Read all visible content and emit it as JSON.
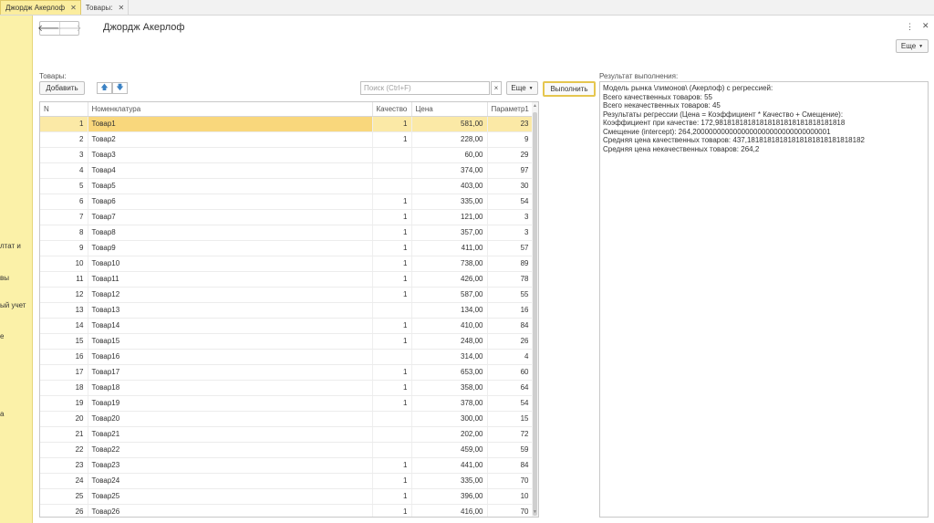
{
  "tabs": [
    {
      "label": "Джордж Акерлоф",
      "active": true
    },
    {
      "label": "Товары:",
      "active": false
    }
  ],
  "sidebar": {
    "items": [
      "",
      "лтат и",
      "вы",
      "ый учет",
      "е",
      "а"
    ]
  },
  "header": {
    "title": "Джордж Акерлоф",
    "more_label": "Еще"
  },
  "goods_panel": {
    "label": "Товары:",
    "add_label": "Добавить",
    "search_placeholder": "Поиск (Ctrl+F)",
    "clear_label": "×",
    "more_label": "Еще",
    "run_label": "Выполнить",
    "columns": [
      "N",
      "Номенклатура",
      "Качество",
      "Цена",
      "Параметр1"
    ],
    "rows": [
      {
        "n": "1",
        "name": "Товар1",
        "quality": "1",
        "price": "581,00",
        "param": "23"
      },
      {
        "n": "2",
        "name": "Товар2",
        "quality": "1",
        "price": "228,00",
        "param": "9"
      },
      {
        "n": "3",
        "name": "Товар3",
        "quality": "",
        "price": "60,00",
        "param": "29"
      },
      {
        "n": "4",
        "name": "Товар4",
        "quality": "",
        "price": "374,00",
        "param": "97"
      },
      {
        "n": "5",
        "name": "Товар5",
        "quality": "",
        "price": "403,00",
        "param": "30"
      },
      {
        "n": "6",
        "name": "Товар6",
        "quality": "1",
        "price": "335,00",
        "param": "54"
      },
      {
        "n": "7",
        "name": "Товар7",
        "quality": "1",
        "price": "121,00",
        "param": "3"
      },
      {
        "n": "8",
        "name": "Товар8",
        "quality": "1",
        "price": "357,00",
        "param": "3"
      },
      {
        "n": "9",
        "name": "Товар9",
        "quality": "1",
        "price": "411,00",
        "param": "57"
      },
      {
        "n": "10",
        "name": "Товар10",
        "quality": "1",
        "price": "738,00",
        "param": "89"
      },
      {
        "n": "11",
        "name": "Товар11",
        "quality": "1",
        "price": "426,00",
        "param": "78"
      },
      {
        "n": "12",
        "name": "Товар12",
        "quality": "1",
        "price": "587,00",
        "param": "55"
      },
      {
        "n": "13",
        "name": "Товар13",
        "quality": "",
        "price": "134,00",
        "param": "16"
      },
      {
        "n": "14",
        "name": "Товар14",
        "quality": "1",
        "price": "410,00",
        "param": "84"
      },
      {
        "n": "15",
        "name": "Товар15",
        "quality": "1",
        "price": "248,00",
        "param": "26"
      },
      {
        "n": "16",
        "name": "Товар16",
        "quality": "",
        "price": "314,00",
        "param": "4"
      },
      {
        "n": "17",
        "name": "Товар17",
        "quality": "1",
        "price": "653,00",
        "param": "60"
      },
      {
        "n": "18",
        "name": "Товар18",
        "quality": "1",
        "price": "358,00",
        "param": "64"
      },
      {
        "n": "19",
        "name": "Товар19",
        "quality": "1",
        "price": "378,00",
        "param": "54"
      },
      {
        "n": "20",
        "name": "Товар20",
        "quality": "",
        "price": "300,00",
        "param": "15"
      },
      {
        "n": "21",
        "name": "Товар21",
        "quality": "",
        "price": "202,00",
        "param": "72"
      },
      {
        "n": "22",
        "name": "Товар22",
        "quality": "",
        "price": "459,00",
        "param": "59"
      },
      {
        "n": "23",
        "name": "Товар23",
        "quality": "1",
        "price": "441,00",
        "param": "84"
      },
      {
        "n": "24",
        "name": "Товар24",
        "quality": "1",
        "price": "335,00",
        "param": "70"
      },
      {
        "n": "25",
        "name": "Товар25",
        "quality": "1",
        "price": "396,00",
        "param": "10"
      },
      {
        "n": "26",
        "name": "Товар26",
        "quality": "1",
        "price": "416,00",
        "param": "70"
      }
    ]
  },
  "result_panel": {
    "label": "Результат выполнения:",
    "lines": [
      "Модель рынка \\лимонов\\ (Акерлоф) с регрессией:",
      "Всего качественных товаров: 55",
      "Всего некачественных товаров: 45",
      "Результаты регрессии (Цена = Коэффициент * Качество + Смещение):",
      "Коэффициент при качестве: 172,98181818181818181818181818181818",
      "Смещение (intercept): 264,2000000000000000000000000000000001",
      "Средняя цена качественных товаров: 437,18181818181818181818181818182",
      "Средняя цена некачественных товаров: 264,2"
    ]
  }
}
